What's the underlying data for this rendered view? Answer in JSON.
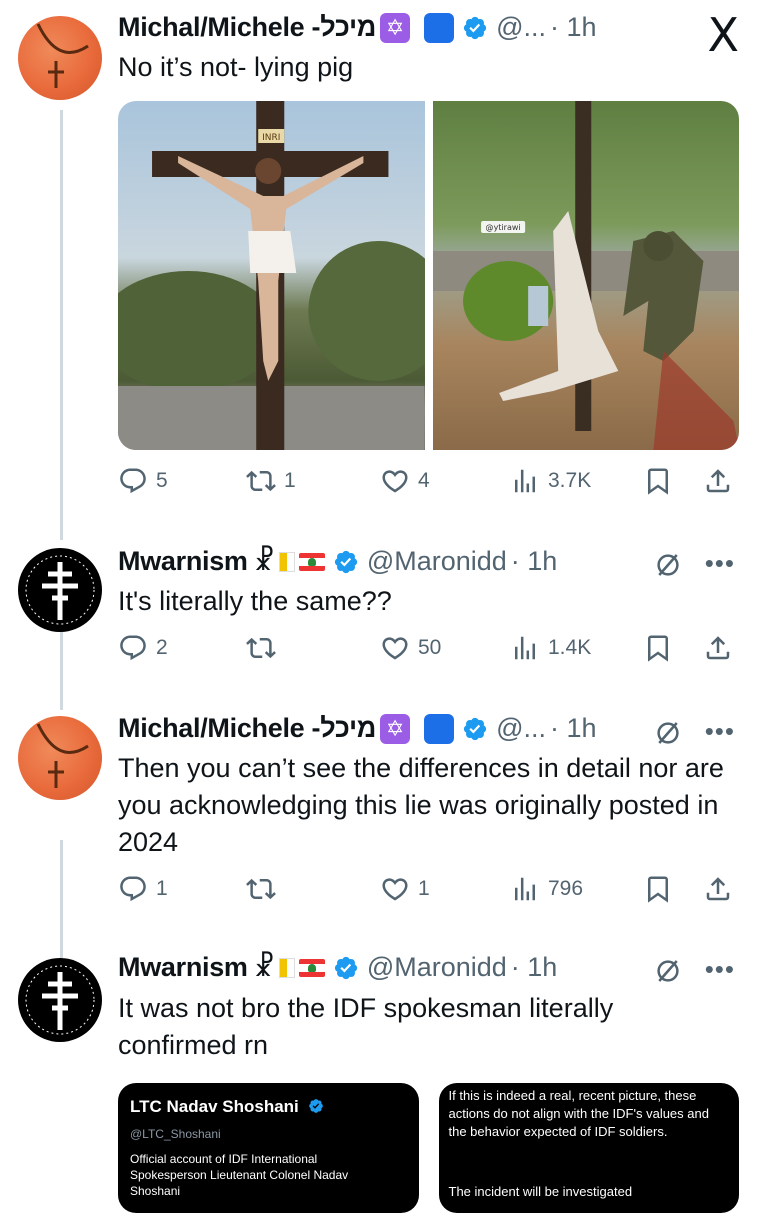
{
  "app": {
    "logo": "X"
  },
  "tweets": [
    {
      "name": "Michal/Michele -מיכל",
      "handle": "@...",
      "time": "· 1h",
      "text": "No it’s not- lying pig",
      "media": {
        "right_watermark": "@ytirawi",
        "left_sign": "INRI"
      },
      "stats": {
        "replies": "5",
        "reposts": "1",
        "likes": "4",
        "views": "3.7K"
      }
    },
    {
      "name": "Mwarnism",
      "handle": "@Maronidd",
      "time": "· 1h",
      "text": "It's literally the same??",
      "stats": {
        "replies": "2",
        "reposts": "",
        "likes": "50",
        "views": "1.4K"
      }
    },
    {
      "name": "Michal/Michele -מיכל",
      "handle": "@...",
      "time": "· 1h",
      "text": "Then you can’t see the differences in detail nor are you acknowledging this lie was originally posted in 2024",
      "stats": {
        "replies": "1",
        "reposts": "",
        "likes": "1",
        "views": "796"
      }
    },
    {
      "name": "Mwarnism",
      "handle": "@Maronidd",
      "time": "· 1h",
      "text": "It was not bro the IDF spokesman literally confirmed rn",
      "card": {
        "left_name": "LTC Nadav Shoshani",
        "left_handle": "@LTC_Shoshani",
        "left_bio": "Official account of IDF International Spokesperson Lieutenant Colonel Nadav Shoshani",
        "right_text": "If this is indeed a real, recent picture, these actions do not align with the IDF's values and the behavior expected of IDF soldiers.",
        "right_text2": "The incident will be investigated"
      }
    }
  ],
  "colors": {
    "verified": "#1d9bf0",
    "muted_text": "#536471",
    "thread_line": "#cfd9de"
  },
  "icons": [
    "x-logo-icon",
    "reply-icon",
    "repost-icon",
    "like-icon",
    "views-icon",
    "bookmark-icon",
    "share-icon",
    "mute-icon",
    "more-icon",
    "verified-icon",
    "star-of-david-icon",
    "blue-square-icon",
    "chi-rho-icon",
    "vatican-flag-icon",
    "lebanon-flag-icon"
  ]
}
